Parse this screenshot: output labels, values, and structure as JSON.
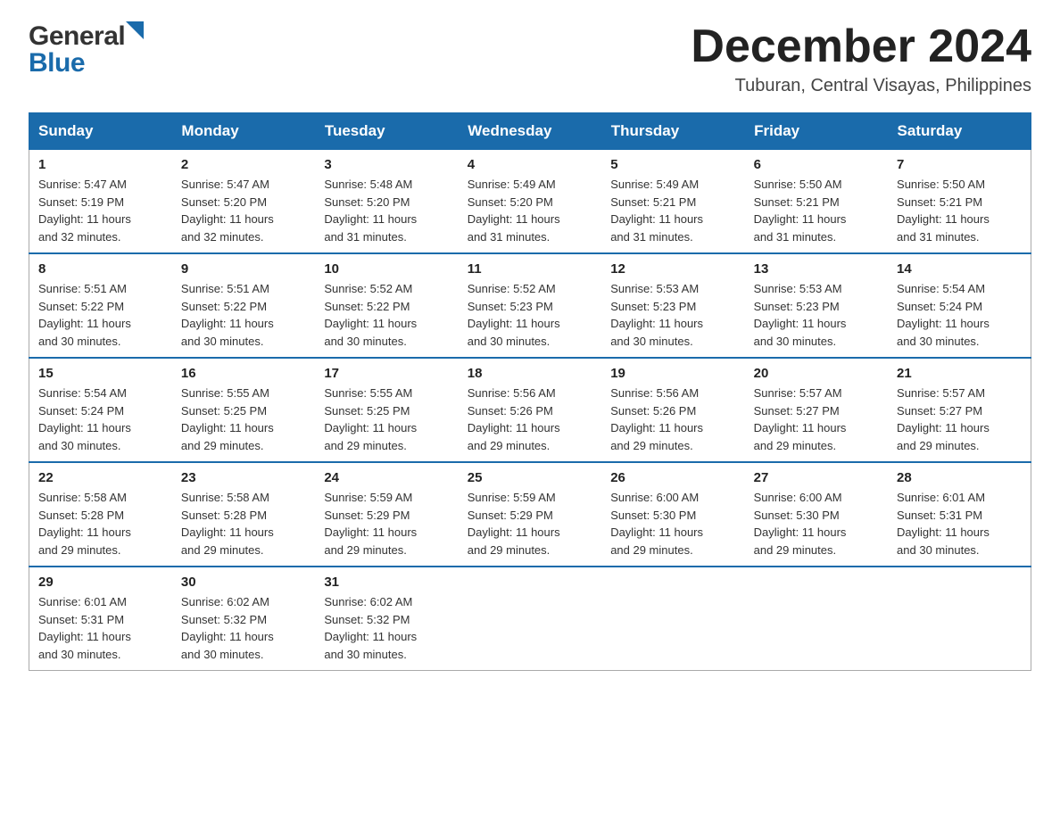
{
  "header": {
    "logo_general": "General",
    "logo_blue": "Blue",
    "month_year": "December 2024",
    "location": "Tuburan, Central Visayas, Philippines"
  },
  "days_of_week": [
    "Sunday",
    "Monday",
    "Tuesday",
    "Wednesday",
    "Thursday",
    "Friday",
    "Saturday"
  ],
  "weeks": [
    [
      {
        "day": "1",
        "sunrise": "5:47 AM",
        "sunset": "5:19 PM",
        "daylight": "11 hours and 32 minutes."
      },
      {
        "day": "2",
        "sunrise": "5:47 AM",
        "sunset": "5:20 PM",
        "daylight": "11 hours and 32 minutes."
      },
      {
        "day": "3",
        "sunrise": "5:48 AM",
        "sunset": "5:20 PM",
        "daylight": "11 hours and 31 minutes."
      },
      {
        "day": "4",
        "sunrise": "5:49 AM",
        "sunset": "5:20 PM",
        "daylight": "11 hours and 31 minutes."
      },
      {
        "day": "5",
        "sunrise": "5:49 AM",
        "sunset": "5:21 PM",
        "daylight": "11 hours and 31 minutes."
      },
      {
        "day": "6",
        "sunrise": "5:50 AM",
        "sunset": "5:21 PM",
        "daylight": "11 hours and 31 minutes."
      },
      {
        "day": "7",
        "sunrise": "5:50 AM",
        "sunset": "5:21 PM",
        "daylight": "11 hours and 31 minutes."
      }
    ],
    [
      {
        "day": "8",
        "sunrise": "5:51 AM",
        "sunset": "5:22 PM",
        "daylight": "11 hours and 30 minutes."
      },
      {
        "day": "9",
        "sunrise": "5:51 AM",
        "sunset": "5:22 PM",
        "daylight": "11 hours and 30 minutes."
      },
      {
        "day": "10",
        "sunrise": "5:52 AM",
        "sunset": "5:22 PM",
        "daylight": "11 hours and 30 minutes."
      },
      {
        "day": "11",
        "sunrise": "5:52 AM",
        "sunset": "5:23 PM",
        "daylight": "11 hours and 30 minutes."
      },
      {
        "day": "12",
        "sunrise": "5:53 AM",
        "sunset": "5:23 PM",
        "daylight": "11 hours and 30 minutes."
      },
      {
        "day": "13",
        "sunrise": "5:53 AM",
        "sunset": "5:23 PM",
        "daylight": "11 hours and 30 minutes."
      },
      {
        "day": "14",
        "sunrise": "5:54 AM",
        "sunset": "5:24 PM",
        "daylight": "11 hours and 30 minutes."
      }
    ],
    [
      {
        "day": "15",
        "sunrise": "5:54 AM",
        "sunset": "5:24 PM",
        "daylight": "11 hours and 30 minutes."
      },
      {
        "day": "16",
        "sunrise": "5:55 AM",
        "sunset": "5:25 PM",
        "daylight": "11 hours and 29 minutes."
      },
      {
        "day": "17",
        "sunrise": "5:55 AM",
        "sunset": "5:25 PM",
        "daylight": "11 hours and 29 minutes."
      },
      {
        "day": "18",
        "sunrise": "5:56 AM",
        "sunset": "5:26 PM",
        "daylight": "11 hours and 29 minutes."
      },
      {
        "day": "19",
        "sunrise": "5:56 AM",
        "sunset": "5:26 PM",
        "daylight": "11 hours and 29 minutes."
      },
      {
        "day": "20",
        "sunrise": "5:57 AM",
        "sunset": "5:27 PM",
        "daylight": "11 hours and 29 minutes."
      },
      {
        "day": "21",
        "sunrise": "5:57 AM",
        "sunset": "5:27 PM",
        "daylight": "11 hours and 29 minutes."
      }
    ],
    [
      {
        "day": "22",
        "sunrise": "5:58 AM",
        "sunset": "5:28 PM",
        "daylight": "11 hours and 29 minutes."
      },
      {
        "day": "23",
        "sunrise": "5:58 AM",
        "sunset": "5:28 PM",
        "daylight": "11 hours and 29 minutes."
      },
      {
        "day": "24",
        "sunrise": "5:59 AM",
        "sunset": "5:29 PM",
        "daylight": "11 hours and 29 minutes."
      },
      {
        "day": "25",
        "sunrise": "5:59 AM",
        "sunset": "5:29 PM",
        "daylight": "11 hours and 29 minutes."
      },
      {
        "day": "26",
        "sunrise": "6:00 AM",
        "sunset": "5:30 PM",
        "daylight": "11 hours and 29 minutes."
      },
      {
        "day": "27",
        "sunrise": "6:00 AM",
        "sunset": "5:30 PM",
        "daylight": "11 hours and 29 minutes."
      },
      {
        "day": "28",
        "sunrise": "6:01 AM",
        "sunset": "5:31 PM",
        "daylight": "11 hours and 30 minutes."
      }
    ],
    [
      {
        "day": "29",
        "sunrise": "6:01 AM",
        "sunset": "5:31 PM",
        "daylight": "11 hours and 30 minutes."
      },
      {
        "day": "30",
        "sunrise": "6:02 AM",
        "sunset": "5:32 PM",
        "daylight": "11 hours and 30 minutes."
      },
      {
        "day": "31",
        "sunrise": "6:02 AM",
        "sunset": "5:32 PM",
        "daylight": "11 hours and 30 minutes."
      },
      null,
      null,
      null,
      null
    ]
  ],
  "sunrise_label": "Sunrise:",
  "sunset_label": "Sunset:",
  "daylight_label": "Daylight:"
}
